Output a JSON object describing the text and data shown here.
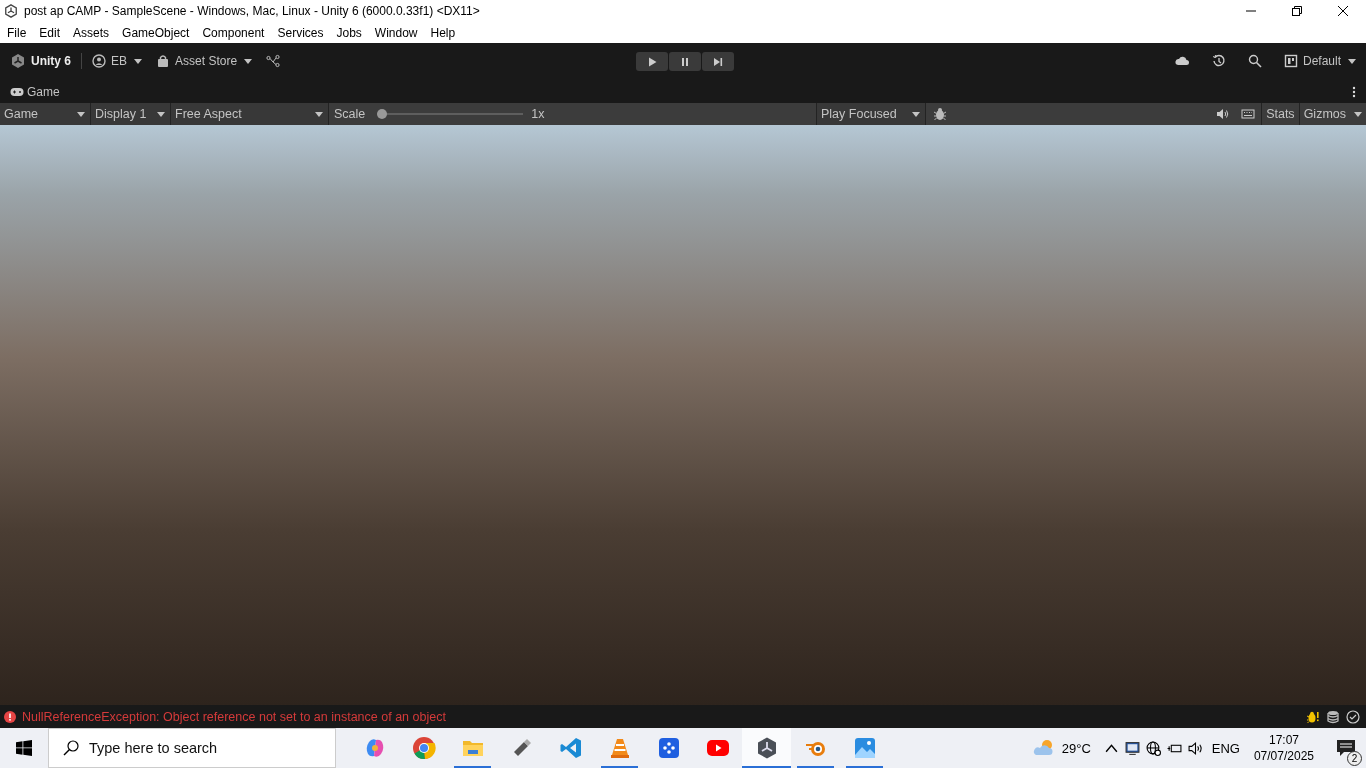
{
  "window": {
    "title": "post ap CAMP - SampleScene - Windows, Mac, Linux - Unity 6 (6000.0.33f1) <DX11>"
  },
  "menu": [
    "File",
    "Edit",
    "Assets",
    "GameObject",
    "Component",
    "Services",
    "Jobs",
    "Window",
    "Help"
  ],
  "toolbar": {
    "product": "Unity 6",
    "account": "EB",
    "asset_store": "Asset Store",
    "layout": "Default"
  },
  "game_tab": {
    "label": "Game"
  },
  "game_toolbar": {
    "view": "Game",
    "display": "Display 1",
    "aspect": "Free Aspect",
    "scale_label": "Scale",
    "scale": {
      "level": 0
    },
    "scale_reading": "1x",
    "play_mode": "Play Focused",
    "stats": "Stats",
    "gizmos": "Gizmos"
  },
  "status_bar": {
    "message": "NullReferenceException: Object reference not set to an instance of an object"
  },
  "taskbar": {
    "search": {
      "placeholder": "Type here to search"
    },
    "apps": [
      {
        "kind": "copilot",
        "running": false,
        "active": false
      },
      {
        "kind": "chrome",
        "running": false,
        "active": false
      },
      {
        "kind": "explorer",
        "running": true,
        "active": false
      },
      {
        "kind": "usb",
        "running": false,
        "active": false
      },
      {
        "kind": "vscode",
        "running": false,
        "active": false
      },
      {
        "kind": "vlc",
        "running": true,
        "active": false
      },
      {
        "kind": "dots",
        "running": false,
        "active": false
      },
      {
        "kind": "youtube",
        "running": false,
        "active": false
      },
      {
        "kind": "unity",
        "running": true,
        "active": true
      },
      {
        "kind": "blender",
        "running": true,
        "active": false
      },
      {
        "kind": "photos",
        "running": true,
        "active": false
      }
    ],
    "temperature": "29°C",
    "language": "ENG",
    "time": "17:07",
    "date": "07/07/2025",
    "notifications": "2"
  }
}
